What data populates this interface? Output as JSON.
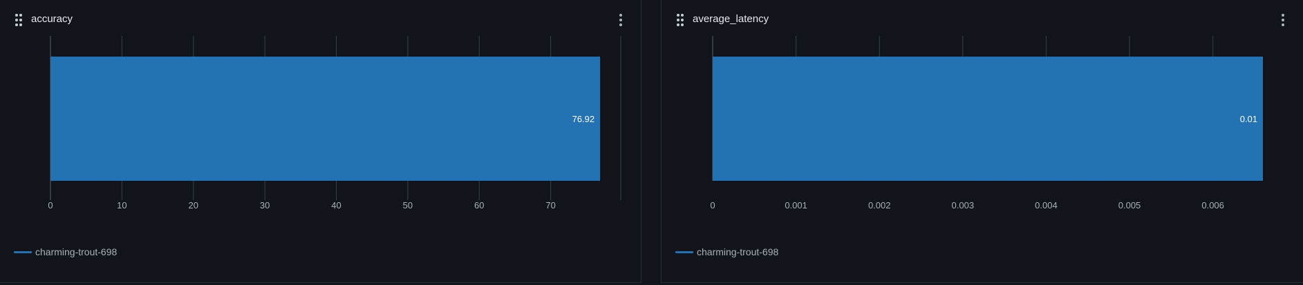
{
  "panels": [
    {
      "title": "accuracy",
      "legend": "charming-trout-698"
    },
    {
      "title": "average_latency",
      "legend": "charming-trout-698"
    }
  ],
  "colors": {
    "bar": "#2272b4",
    "grid": "#3a3f47",
    "axis_text": "#aab0b8",
    "background": "#11151b"
  },
  "chart_data": [
    {
      "type": "bar",
      "orientation": "horizontal",
      "title": "accuracy",
      "categories": [
        "charming-trout-698"
      ],
      "values": [
        76.92
      ],
      "value_labels": [
        "76.92"
      ],
      "xlim": [
        0,
        80
      ],
      "xticks": [
        0,
        10,
        20,
        30,
        40,
        50,
        60,
        70
      ],
      "xtick_labels": [
        "0",
        "10",
        "20",
        "30",
        "40",
        "50",
        "60",
        "70"
      ],
      "grid": true,
      "legend": [
        "charming-trout-698"
      ],
      "legend_position": "bottom-left"
    },
    {
      "type": "bar",
      "orientation": "horizontal",
      "title": "average_latency",
      "categories": [
        "charming-trout-698"
      ],
      "values": [
        0.0066
      ],
      "value_labels": [
        "0.01"
      ],
      "xlim": [
        0,
        0.0066
      ],
      "xticks": [
        0,
        0.001,
        0.002,
        0.003,
        0.004,
        0.005,
        0.006
      ],
      "xtick_labels": [
        "0",
        "0.001",
        "0.002",
        "0.003",
        "0.004",
        "0.005",
        "0.006"
      ],
      "grid": true,
      "legend": [
        "charming-trout-698"
      ],
      "legend_position": "bottom-left"
    }
  ]
}
